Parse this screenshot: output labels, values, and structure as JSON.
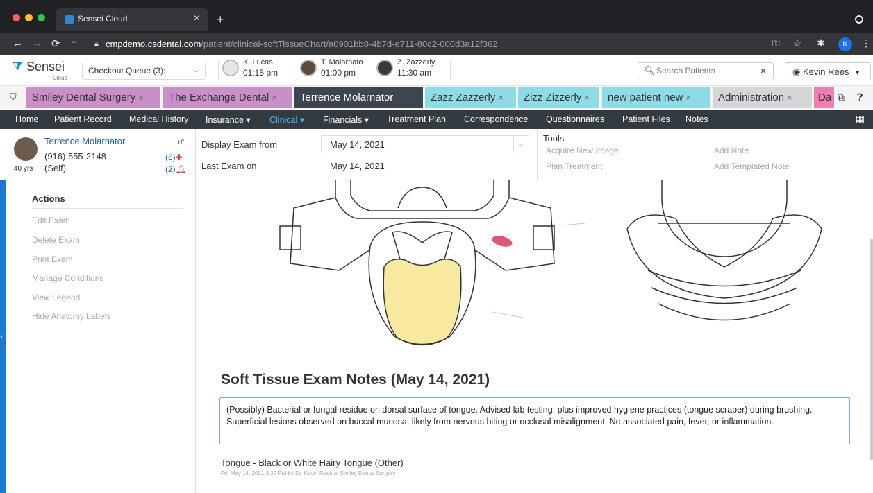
{
  "browser": {
    "tab_title": "Sensei Cloud",
    "url_host": "cmpdemo.csdental.com",
    "url_path": "/patient/clinical-softTissueChart/a0901bb8-4b7d-e711-80c2-000d3a12f362",
    "profile_initial": "K"
  },
  "header": {
    "brand": "Sensei",
    "brand_sub": "Cloud",
    "queue_label": "Checkout Queue (3):",
    "appointments": [
      {
        "name": "K. Lucas",
        "time": "01:15 pm"
      },
      {
        "name": "T. Molarnato",
        "time": "01:00 pm"
      },
      {
        "name": "Z. Zazzerly",
        "time": "11:30 am"
      }
    ],
    "search_placeholder": "Search Patients",
    "user": "Kevin Rees"
  },
  "patient_tabs": [
    {
      "label": "Smiley Dental Surgery",
      "close": "+",
      "color": "#c98fc9"
    },
    {
      "label": "The Exchange Dental",
      "close": "×",
      "color": "#c98fc9"
    },
    {
      "label": "Terrence Molarnator",
      "close": "",
      "color": "#3d4650"
    },
    {
      "label": "Zazz Zazzerly",
      "close": "×",
      "color": "#8edbe8"
    },
    {
      "label": "Zizz Zizzerly",
      "close": "×",
      "color": "#8edbe8"
    },
    {
      "label": "new patient new",
      "close": "×",
      "color": "#8edbe8"
    },
    {
      "label": "Administration",
      "close": "×",
      "color": "#d6d6d6"
    },
    {
      "label": "Da",
      "close": "",
      "color": "#f07fb0"
    }
  ],
  "nav": {
    "items": [
      "Home",
      "Patient Record",
      "Medical History",
      "Insurance ▾",
      "Clinical ▾",
      "Financials ▾",
      "Treatment Plan",
      "Correspondence",
      "Questionnaires",
      "Patient Files",
      "Notes"
    ],
    "active": "Clinical ▾"
  },
  "patient": {
    "name": "Terrence Molarnator",
    "phone": "(916) 555-2148",
    "relation": "(Self)",
    "age": "40 yrs",
    "alerts_medical": "(6)",
    "alerts_bell": "(2)"
  },
  "exam": {
    "display_label": "Display Exam from",
    "display_value": "May 14, 2021",
    "last_label": "Last Exam on",
    "last_value": "May 14, 2021"
  },
  "tools": {
    "title": "Tools",
    "items": [
      "Acquire New Image",
      "Add Note",
      "Plan Treatment",
      "Add Templated Note"
    ]
  },
  "sidebar": {
    "heading": "Actions",
    "items": [
      "Edit Exam",
      "Delete Exam",
      "Print Exam",
      "Manage Conditions",
      "View Legend",
      "Hide Anatomy Labels"
    ]
  },
  "notes": {
    "title": "Soft Tissue Exam Notes (May 14, 2021)",
    "body": "(Possibly) Bacterial or fungal residue on dorsal surface of tongue. Advised lab testing, plus improved hygiene practices (tongue scraper) during brushing. Superficial lesions observed on buccal mucosa, likely from nervous biting or occlusal misalignment. No associated pain, fever, or inflammation.",
    "entry_title": "Tongue - Black or White Hairy Tongue (Other)",
    "entry_meta": "Fri, May 14, 2021 3:37 PM by Dr. Kevin Rees at Smiley Dental Surgery"
  },
  "colors": {
    "accent": "#1b78d1",
    "tongue": "#f7e9a0",
    "lesion": "#e0567a"
  }
}
